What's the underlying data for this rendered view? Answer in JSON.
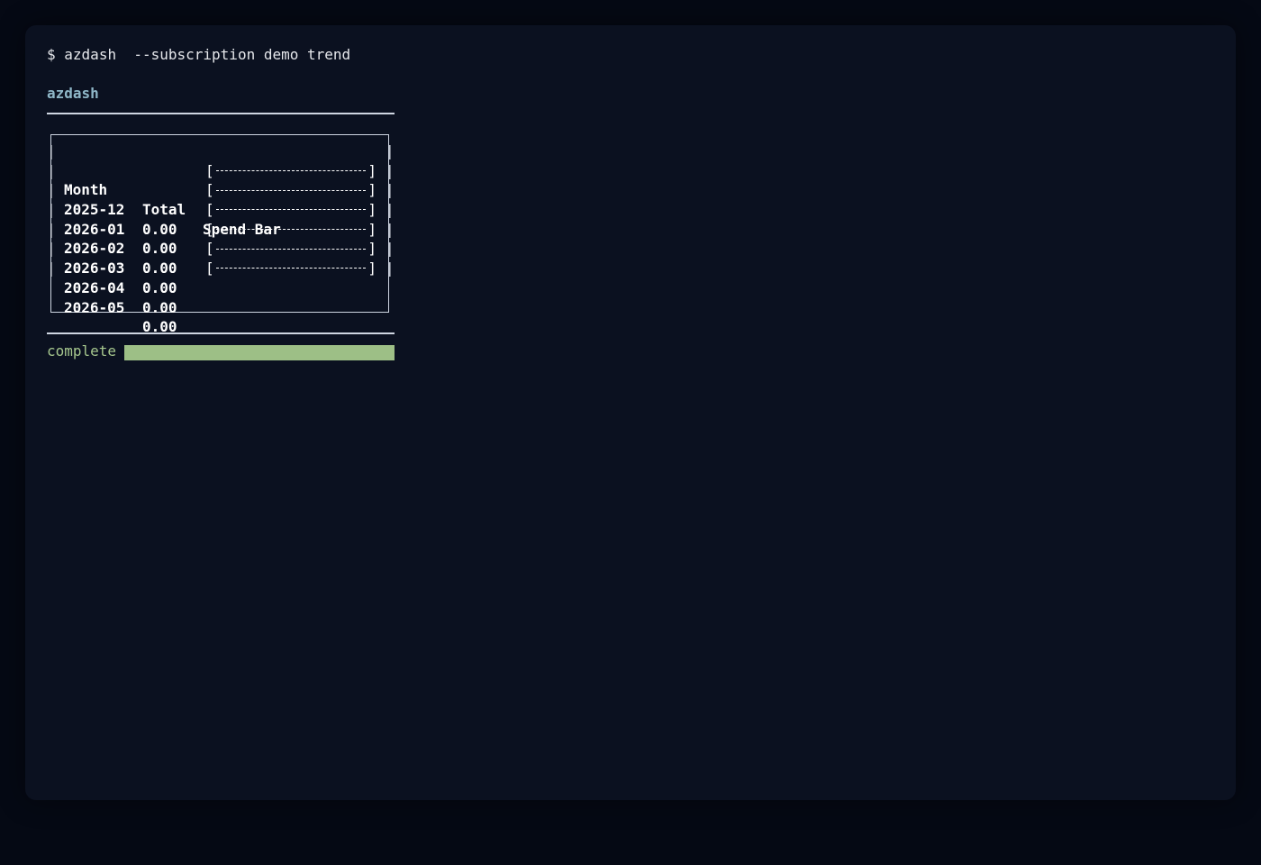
{
  "terminal": {
    "prompt_symbol": "$",
    "command": "azdash  --subscription demo trend",
    "app_title": "azdash",
    "colors": {
      "background": "#0b1120",
      "page_background": "#050914",
      "text": "#e5e7eb",
      "title": "#8fb7c8",
      "success": "#a6c78e"
    }
  },
  "table": {
    "headers": [
      "Month",
      "Total",
      "Spend Bar"
    ],
    "rows": [
      {
        "month": "2025-12",
        "total": "0.00"
      },
      {
        "month": "2026-01",
        "total": "0.00"
      },
      {
        "month": "2026-02",
        "total": "0.00"
      },
      {
        "month": "2026-03",
        "total": "0.00"
      },
      {
        "month": "2026-04",
        "total": "0.00"
      },
      {
        "month": "2026-05",
        "total": "0.00"
      }
    ],
    "spend_bar_fill": [
      0,
      0,
      0,
      0,
      0,
      0
    ]
  },
  "status": {
    "label": "complete",
    "progress": 1.0
  }
}
